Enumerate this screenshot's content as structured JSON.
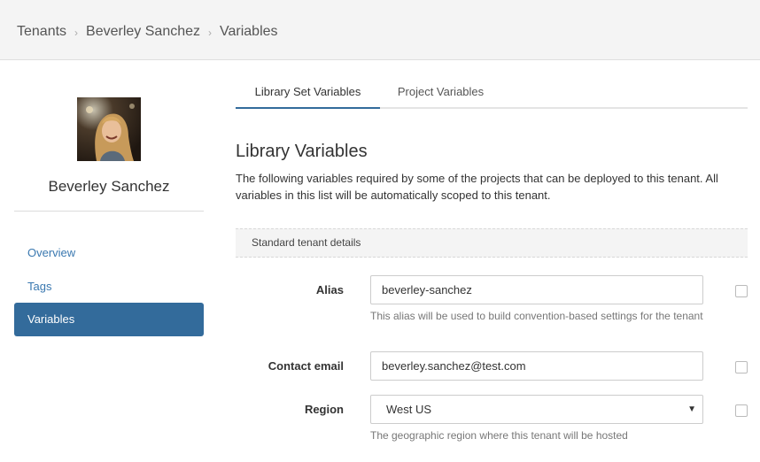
{
  "breadcrumb": {
    "items": [
      "Tenants",
      "Beverley Sanchez",
      "Variables"
    ],
    "separator": "›"
  },
  "tenant": {
    "name": "Beverley Sanchez"
  },
  "sidebar": {
    "items": [
      {
        "label": "Overview"
      },
      {
        "label": "Tags"
      },
      {
        "label": "Variables",
        "active": true
      }
    ]
  },
  "tabs": [
    {
      "label": "Library Set Variables",
      "active": true
    },
    {
      "label": "Project Variables"
    }
  ],
  "library": {
    "title": "Library Variables",
    "description": "The following variables required by some of the projects that can be deployed to this tenant. All variables in this list will be automatically scoped to this tenant.",
    "group_header": "Standard tenant details"
  },
  "fields": {
    "alias": {
      "label": "Alias",
      "value": "beverley-sanchez",
      "help": "This alias will be used to build convention-based settings for the tenant"
    },
    "contact_email": {
      "label": "Contact email",
      "value": "beverley.sanchez@test.com"
    },
    "region": {
      "label": "Region",
      "value": "West US",
      "help": "The geographic region where this tenant will be hosted"
    }
  },
  "colors": {
    "accent": "#336b9b",
    "link": "#3a78b0",
    "topbar": "#f4f4f4"
  }
}
